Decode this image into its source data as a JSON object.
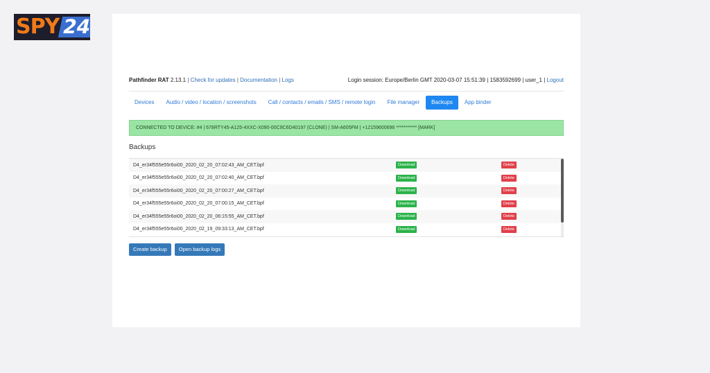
{
  "logo": {
    "text_a": "SPY",
    "text_b": "24"
  },
  "header": {
    "app_name": "Pathfinder RAT",
    "version": "2.13.1",
    "links": [
      "Check for updates",
      "Documentation",
      "Logs"
    ],
    "session": "Login session: Europe/Berlin GMT 2020-03-07 15:51:39 | 1583592699 | user_1 |",
    "logout": "Logout"
  },
  "nav": {
    "tabs": [
      "Devices",
      "Audio / video / location / screenshots",
      "Call / contacts / emails / SMS / remote login",
      "File manager",
      "Backups",
      "App binder"
    ],
    "active": "Backups"
  },
  "alert": "CONNECTED TO DEVICE: #4 | 678RTY45-A125-4XXC-X090-00C9C6D40197 (CLONE) | SM-A605FM | +12159600696 *********** [MARK]",
  "backups": {
    "title": "Backups",
    "download_label": "Download",
    "delete_label": "Delete",
    "files": [
      "D4_er34f555e55r6oi00_2020_02_20_07:02:43_AM_CET.bpf",
      "D4_er34f555e55r6oi00_2020_02_20_07:02:40_AM_CET.bpf",
      "D4_er34f555e55r6oi00_2020_02_20_07:00:27_AM_CET.bpf",
      "D4_er34f555e55r6oi00_2020_02_20_07:00:15_AM_CET.bpf",
      "D4_er34f555e55r6oi00_2020_02_20_06:15:55_AM_CET.bpf",
      "D4_er34f555e55r6oi00_2020_02_19_09:33:13_AM_CET.bpf"
    ]
  },
  "actions": {
    "create": "Create backup",
    "open_logs": "Open backup logs"
  }
}
